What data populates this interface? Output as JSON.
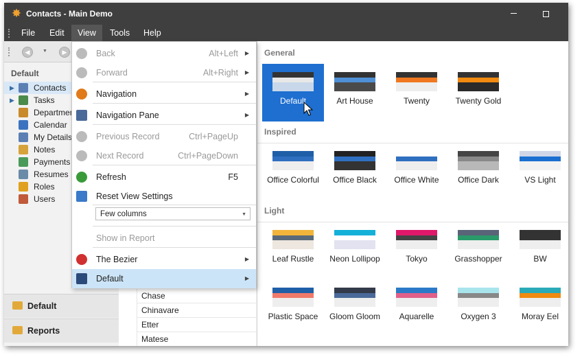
{
  "window": {
    "title": "Contacts - Main Demo"
  },
  "menubar": {
    "items": [
      "File",
      "Edit",
      "View",
      "Tools",
      "Help"
    ],
    "active": "View"
  },
  "nav": {
    "header": "Default",
    "items": [
      {
        "label": "Contacts",
        "icon": "contacts-icon",
        "color": "#5b7fb3",
        "expand": true,
        "selected": true
      },
      {
        "label": "Tasks",
        "icon": "tasks-icon",
        "color": "#4a8a4a",
        "expand": true
      },
      {
        "label": "Departments",
        "icon": "departments-icon",
        "color": "#c88a2a"
      },
      {
        "label": "Calendar",
        "icon": "calendar-icon",
        "color": "#3b73c0"
      },
      {
        "label": "My Details",
        "icon": "my-details-icon",
        "color": "#5b7fb3"
      },
      {
        "label": "Notes",
        "icon": "notes-icon",
        "color": "#d6a23a"
      },
      {
        "label": "Payments",
        "icon": "payments-icon",
        "color": "#4a9a5a"
      },
      {
        "label": "Resumes",
        "icon": "resumes-icon",
        "color": "#6a8aa8"
      },
      {
        "label": "Roles",
        "icon": "roles-icon",
        "color": "#e0a020"
      },
      {
        "label": "Users",
        "icon": "users-icon",
        "color": "#c05a3a"
      }
    ],
    "groups": [
      "Default",
      "Reports"
    ]
  },
  "grid": {
    "rows": [
      "Chase",
      "Chinavare",
      "Etter",
      "Matese"
    ]
  },
  "view_menu": {
    "items": [
      {
        "name": "back",
        "label": "Back",
        "shortcut": "Alt+Left",
        "disabled": true,
        "submenu": true,
        "icon": "back-icon",
        "color": "#bbbbbb"
      },
      {
        "name": "forward",
        "label": "Forward",
        "shortcut": "Alt+Right",
        "disabled": true,
        "submenu": true,
        "icon": "forward-icon",
        "color": "#bbbbbb"
      },
      {
        "name": "navigation",
        "label": "Navigation",
        "submenu": true,
        "icon": "compass-icon",
        "color": "#e07a1a"
      },
      {
        "name": "navigation-pane",
        "label": "Navigation Pane",
        "submenu": true,
        "icon": "pane-icon",
        "color": "#4a6a9a"
      },
      {
        "name": "previous-record",
        "label": "Previous Record",
        "shortcut": "Ctrl+PageUp",
        "disabled": true,
        "icon": "previous-record-icon",
        "color": "#bbbbbb"
      },
      {
        "name": "next-record",
        "label": "Next Record",
        "shortcut": "Ctrl+PageDown",
        "disabled": true,
        "icon": "next-record-icon",
        "color": "#bbbbbb"
      },
      {
        "name": "refresh",
        "label": "Refresh",
        "shortcut": "F5",
        "icon": "refresh-icon",
        "color": "#3a9a3a"
      },
      {
        "name": "reset-view-settings",
        "label": "Reset View Settings",
        "icon": "reset-view-icon",
        "color": "#3a7ac8"
      },
      {
        "name": "show-in-report",
        "label": "Show in Report",
        "disabled": true
      },
      {
        "name": "the-bezier",
        "label": "The Bezier",
        "submenu": true,
        "icon": "bezier-icon",
        "color": "#d03030"
      },
      {
        "name": "default-skin",
        "label": "Default",
        "submenu": true,
        "highlighted": true,
        "icon": "skin-icon",
        "color": "#2a4a7a"
      }
    ],
    "columns_combo": "Few columns"
  },
  "skins": {
    "general_label": "General",
    "inspired_label": "Inspired",
    "light_label": "Light",
    "general": [
      {
        "label": "Default",
        "selected": true,
        "colors": [
          "#333333",
          "#e8e8e8",
          "#c8d8ea"
        ]
      },
      {
        "label": "Art House",
        "colors": [
          "#333333",
          "#4f8fd6",
          "#4a4a4a"
        ]
      },
      {
        "label": "Twenty",
        "colors": [
          "#333333",
          "#f07820",
          "#eeeeee"
        ]
      },
      {
        "label": "Twenty Gold",
        "colors": [
          "#333333",
          "#f08a10",
          "#2a2a2a"
        ]
      }
    ],
    "inspired": [
      {
        "label": "Office Colorful",
        "colors": [
          "#1f5fa8",
          "#2f6fc0",
          "#eeeeee"
        ]
      },
      {
        "label": "Office Black",
        "colors": [
          "#222222",
          "#2f6fc0",
          "#333333"
        ]
      },
      {
        "label": "Office White",
        "colors": [
          "#ffffff",
          "#2f6fc0",
          "#eeeeee"
        ]
      },
      {
        "label": "Office Dark",
        "colors": [
          "#444444",
          "#888888",
          "#b8b8b8"
        ]
      },
      {
        "label": "VS Light",
        "colors": [
          "#cfd6e8",
          "#1a6fd0",
          "#f2f2f2"
        ]
      }
    ],
    "light": [
      {
        "label": "Leaf Rustle",
        "colors": [
          "#f2b43a",
          "#5a6a7a",
          "#ede7df"
        ]
      },
      {
        "label": "Neon Lollipop",
        "colors": [
          "#14b0d8",
          "#ffffff",
          "#e2e2f0"
        ]
      },
      {
        "label": "Tokyo",
        "colors": [
          "#e0186a",
          "#444444",
          "#eeeeee"
        ]
      },
      {
        "label": "Grasshopper",
        "colors": [
          "#5a6478",
          "#2a9a6a",
          "#eeeeee"
        ]
      },
      {
        "label": "BW",
        "colors": [
          "#333333",
          "#333333",
          "#eeeeee"
        ]
      },
      {
        "label": "Plastic Space",
        "colors": [
          "#1f5fa8",
          "#f07a6a",
          "#eeeeee"
        ]
      },
      {
        "label": "Gloom Gloom",
        "colors": [
          "#333a4a",
          "#4a6a9a",
          "#eeeeee"
        ]
      },
      {
        "label": "Aquarelle",
        "colors": [
          "#2a7ac8",
          "#e0608a",
          "#eeeeee"
        ]
      },
      {
        "label": "Oxygen 3",
        "colors": [
          "#a8e4ec",
          "#888888",
          "#eeeeee"
        ]
      },
      {
        "label": "Moray Eel",
        "colors": [
          "#2aaab8",
          "#f08a10",
          "#eeeeee"
        ]
      }
    ]
  }
}
